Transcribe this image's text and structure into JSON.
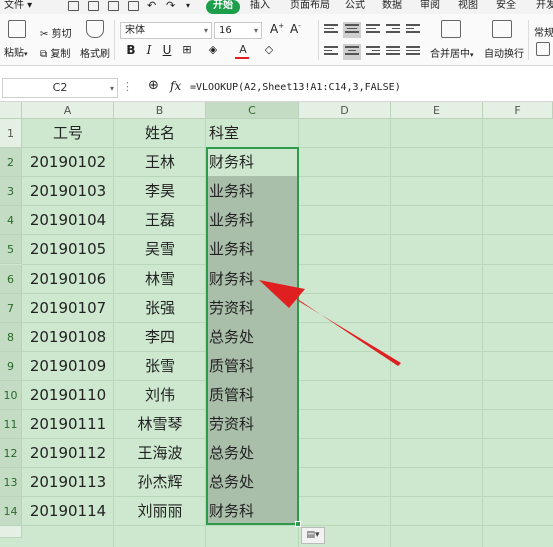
{
  "menu": {
    "file": "文件",
    "home": "开始",
    "insert": "插入",
    "page_layout": "页面布局",
    "formulas": "公式",
    "data": "数据",
    "review": "审阅",
    "view": "视图",
    "security": "安全",
    "dev": "开发"
  },
  "ribbon": {
    "paste": "粘贴",
    "cut": "剪切",
    "copy": "复制",
    "format_painter": "格式刷",
    "font_name": "宋体",
    "font_size": "16",
    "merge_center": "合并居中",
    "wrap_text": "自动换行",
    "regular": "常规"
  },
  "formula_bar": {
    "cell_ref": "C2",
    "fx": "fx",
    "formula": "=VLOOKUP(A2,Sheet13!A1:C14,3,FALSE)"
  },
  "columns": [
    "A",
    "B",
    "C",
    "D",
    "E",
    "F"
  ],
  "rows": [
    "1",
    "2",
    "3",
    "4",
    "5",
    "6",
    "7",
    "8",
    "9",
    "10",
    "11",
    "12",
    "13",
    "14"
  ],
  "table": {
    "headers": [
      "工号",
      "姓名",
      "科室"
    ],
    "data": [
      [
        "20190102",
        "王林",
        "财务科"
      ],
      [
        "20190103",
        "李昊",
        "业务科"
      ],
      [
        "20190104",
        "王磊",
        "业务科"
      ],
      [
        "20190105",
        "吴雪",
        "业务科"
      ],
      [
        "20190106",
        "林雪",
        "财务科"
      ],
      [
        "20190107",
        "张强",
        "劳资科"
      ],
      [
        "20190108",
        "李四",
        "总务处"
      ],
      [
        "20190109",
        "张雪",
        "质管科"
      ],
      [
        "20190110",
        "刘伟",
        "质管科"
      ],
      [
        "20190111",
        "林雪琴",
        "劳资科"
      ],
      [
        "20190112",
        "王海波",
        "总务处"
      ],
      [
        "20190113",
        "孙杰辉",
        "总务处"
      ],
      [
        "20190114",
        "刘丽丽",
        "财务科"
      ]
    ]
  },
  "colors": {
    "sheet_bg": "#cde8cf",
    "selection_border": "#2f9a4c",
    "selection_fill": "#a9bfaa",
    "annotation_arrow": "#e02020",
    "active_tab": "#1d9e4b"
  }
}
